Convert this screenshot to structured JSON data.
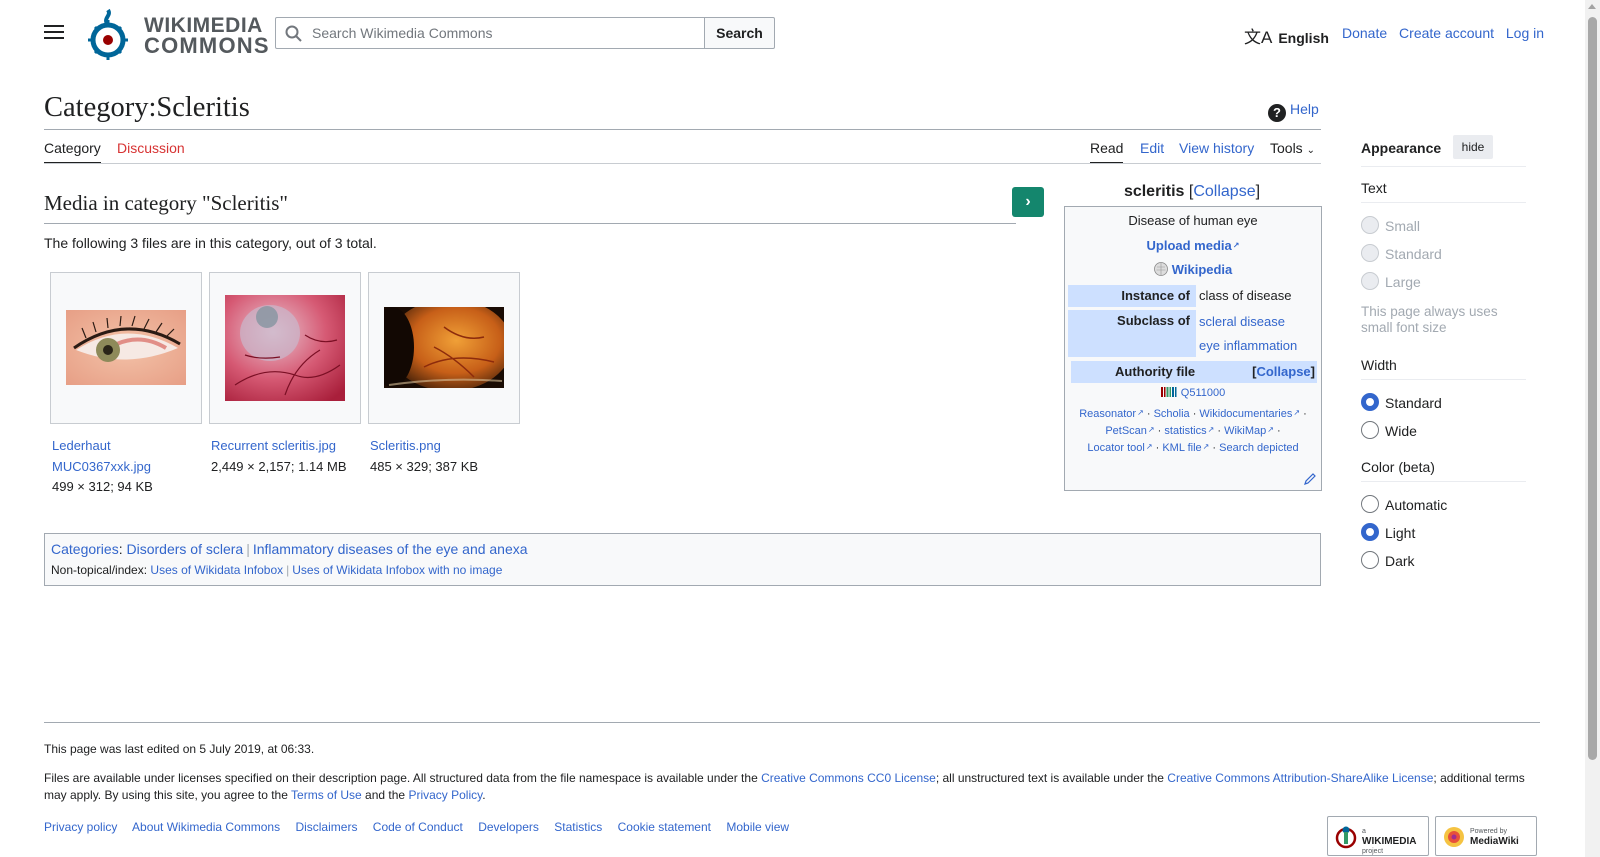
{
  "header": {
    "logo_line1": "WIKIMEDIA",
    "logo_line2": "COMMONS",
    "search_placeholder": "Search Wikimedia Commons",
    "search_button": "Search",
    "language": "English",
    "user_links": [
      "Donate",
      "Create account",
      "Log in"
    ]
  },
  "page": {
    "title": "Category:Scleritis",
    "help": "Help",
    "tabs_left": [
      "Category",
      "Discussion"
    ],
    "tabs_right": [
      "Read",
      "Edit",
      "View history",
      "Tools"
    ]
  },
  "media": {
    "heading": "Media in category \"Scleritis\"",
    "count_text": "The following 3 files are in this category, out of 3 total.",
    "files": [
      {
        "name_line1": "Lederhaut",
        "name_line2": "MUC0367xxk.jpg",
        "meta": "499 × 312; 94 KB"
      },
      {
        "name_line1": "Recurrent scleritis.jpg",
        "meta": "2,449 × 2,157; 1.14 MB"
      },
      {
        "name_line1": "Scleritis.png",
        "meta": "485 × 329; 387 KB"
      }
    ]
  },
  "infobox": {
    "title": "scleritis",
    "collapse": "Collapse",
    "description": "Disease of human eye",
    "upload": "Upload media",
    "wikipedia": "Wikipedia",
    "instance_of_label": "Instance of",
    "instance_of_value": "class of disease",
    "subclass_of_label": "Subclass of",
    "subclass_values": [
      "scleral disease",
      "eye inflammation"
    ],
    "authority_label": "Authority file",
    "authority_collapse": "Collapse",
    "qid": "Q511000",
    "links_row1": [
      "Reasonator",
      "Scholia",
      "Wikidocumentaries"
    ],
    "links_row2": [
      "PetScan",
      "statistics",
      "WikiMap"
    ],
    "links_row3": [
      "Locator tool",
      "KML file",
      "Search depicted"
    ]
  },
  "catlinks": {
    "label": "Categories",
    "items": [
      "Disorders of sclera",
      "Inflammatory diseases of the eye and anexa"
    ],
    "hidden_label": "Non-topical/index:",
    "hidden_items": [
      "Uses of Wikidata Infobox",
      "Uses of Wikidata Infobox with no image"
    ]
  },
  "appearance": {
    "title": "Appearance",
    "hide": "hide",
    "text_heading": "Text",
    "text_options": [
      "Small",
      "Standard",
      "Large"
    ],
    "text_note": "This page always uses small font size",
    "width_heading": "Width",
    "width_options": [
      "Standard",
      "Wide"
    ],
    "width_selected": "Standard",
    "color_heading": "Color (beta)",
    "color_options": [
      "Automatic",
      "Light",
      "Dark"
    ],
    "color_selected": "Light"
  },
  "footer": {
    "last_edited": "This page was last edited on 5 July 2019, at 06:33.",
    "license_pre": "Files are available under licenses specified on their description page. All structured data from the file namespace is available under the ",
    "license_link1": "Creative Commons CC0 License",
    "license_mid": "; all unstructured text is available under the ",
    "license_link2": "Creative Commons Attribution-ShareAlike License",
    "license_post": "; additional terms may apply. By using this site, you agree to the ",
    "terms": "Terms of Use",
    "and_the": " and the ",
    "privacy": "Privacy Policy",
    "period": ".",
    "links": [
      "Privacy policy",
      "About Wikimedia Commons",
      "Disclaimers",
      "Code of Conduct",
      "Developers",
      "Statistics",
      "Cookie statement",
      "Mobile view"
    ],
    "badge1_small": "a",
    "badge1_main": "WIKIMEDIA",
    "badge1_sub": "project",
    "badge2_small": "Powered by",
    "badge2_main": "MediaWiki"
  },
  "colors": {
    "link": "#3366cc",
    "red_link": "#d73333",
    "button_green": "#14866d",
    "infobox_label_bg": "#cde0ff"
  }
}
